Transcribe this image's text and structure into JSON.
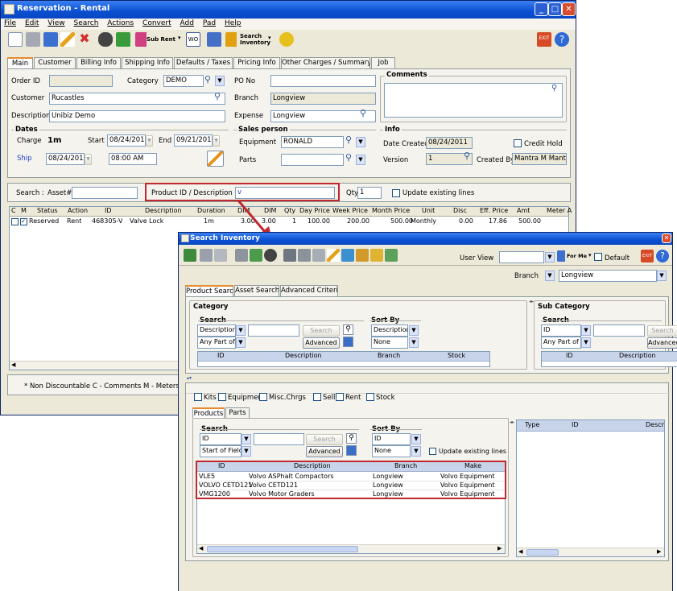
{
  "main": {
    "title": "Reservation - Rental",
    "menu": [
      "File",
      "Edit",
      "View",
      "Search",
      "Actions",
      "Convert",
      "Add",
      "Pad",
      "Help"
    ],
    "toolbar": {
      "sub_rent": "Sub Rent",
      "wo": "WO",
      "search_inventory_1": "Search",
      "search_inventory_2": "Inventory",
      "exit": "EXIT"
    },
    "tabs": [
      "Main",
      "Customer",
      "Billing Info",
      "Shipping Info",
      "Defaults / Taxes",
      "Pricing Info",
      "Other Charges / Summary",
      "Job"
    ],
    "form": {
      "order_id_label": "Order ID",
      "order_id": "",
      "category_label": "Category",
      "category": "DEMO",
      "po_label": "PO No",
      "po": "",
      "comments_label": "Comments",
      "customer_label": "Customer",
      "customer": "Rucastles",
      "branch_label": "Branch",
      "branch": "Longview",
      "description_label": "Description",
      "description": "Unibiz Demo",
      "expense_label": "Expense",
      "expense": "Longview",
      "dates_label": "Dates",
      "charge_label": "Charge",
      "charge": "1m",
      "start_label": "Start",
      "start": "08/24/2011",
      "end_label": "End",
      "end": "09/21/2011",
      "ship_label": "Ship",
      "ship_date": "08/24/2011",
      "ship_time": "08:00 AM",
      "sales_person_label": "Sales person",
      "equipment_label": "Equipment",
      "equipment": "RONALD",
      "parts_label": "Parts",
      "parts": "",
      "info_label": "Info",
      "date_created_label": "Date Created",
      "date_created": "08/24/2011",
      "credit_hold_label": "Credit Hold",
      "version_label": "Version",
      "version": "1",
      "created_by_label": "Created By",
      "created_by": "Mantra M Mantra"
    },
    "search_row": {
      "search_label": "Search :",
      "asset_label": "Asset#",
      "asset": "",
      "product_label": "Product ID / Description",
      "product": "v",
      "qty_label": "Qty",
      "qty": "1",
      "update_label": "Update existing lines"
    },
    "lines": {
      "columns": [
        "C",
        "M",
        "Status",
        "Action",
        "ID",
        "Description",
        "Duration",
        "DIM",
        "DIM",
        "Qty",
        "Day Price",
        "Week Price",
        "Month Price",
        "Unit",
        "Disc",
        "Eff. Price",
        "Amt",
        "Meter A"
      ],
      "rows": [
        {
          "status": "Reserved",
          "action": "Rent",
          "id": "468305-V",
          "description": "Valve Lock",
          "duration": "1m",
          "dim1": "3.00",
          "dim2": "3.00",
          "qty": "1",
          "day": "100.00",
          "week": "200.00",
          "month": "500.00",
          "unit": "Monthly",
          "disc": "0.00",
          "eff": "17.86",
          "amt": "500.00"
        }
      ]
    },
    "status_bar": "* Non Discountable   C - Comments   M - Meters"
  },
  "dialog": {
    "title": "Search Inventory",
    "user_view_label": "User View",
    "user_view": "",
    "for_me": "For Me",
    "default_label": "Default",
    "exit": "EXIT",
    "branch_label": "Branch",
    "branch": "Longview",
    "tabs": [
      "Product Search",
      "Asset Search",
      "Advanced Criteria"
    ],
    "category": {
      "title": "Category",
      "search_label": "Search",
      "search_field": "Description",
      "match": "Any Part of ...",
      "search_btn": "Search",
      "advanced_btn": "Advanced",
      "sort_label": "Sort By",
      "sort1": "Description",
      "sort2": "None",
      "columns": [
        "ID",
        "Description",
        "Branch",
        "Stock"
      ]
    },
    "subcategory": {
      "title": "Sub Category",
      "search_label": "Search",
      "search_field": "ID",
      "match": "Any Part of ...",
      "search_btn": "Search",
      "advanced_btn": "Advanced",
      "columns": [
        "ID",
        "Description"
      ]
    },
    "filters": [
      "Kits",
      "Equipment",
      "Misc.Chrgs",
      "Sell",
      "Rent",
      "Stock"
    ],
    "sub_tabs": [
      "Products",
      "Parts"
    ],
    "products": {
      "search_label": "Search",
      "search_field": "ID",
      "match": "Start of Field",
      "search_btn": "Search",
      "advanced_btn": "Advanced",
      "sort_label": "Sort By",
      "sort1": "ID",
      "sort2": "None",
      "update_label": "Update existing lines",
      "columns": [
        "ID",
        "Description",
        "Branch",
        "Make"
      ],
      "rows": [
        {
          "id": "VLE5",
          "description": "Volvo ASPhalt Compactors",
          "branch": "Longview",
          "make": "Volvo Equipment"
        },
        {
          "id": "VOLVO CETD121",
          "description": "Volvo CETD121",
          "branch": "Longview",
          "make": "Volvo Equipment"
        },
        {
          "id": "VMG1200",
          "description": "Volvo Motor Graders",
          "branch": "Longview",
          "make": "Volvo Equipment"
        }
      ]
    },
    "right_grid": {
      "columns": [
        "Type",
        "ID",
        "Descr"
      ]
    }
  },
  "colors": {
    "title_blue": "#0a4fd0",
    "highlight_red": "#c0282e",
    "grid_header": "#c8d4ea",
    "face": "#ece9d8"
  }
}
